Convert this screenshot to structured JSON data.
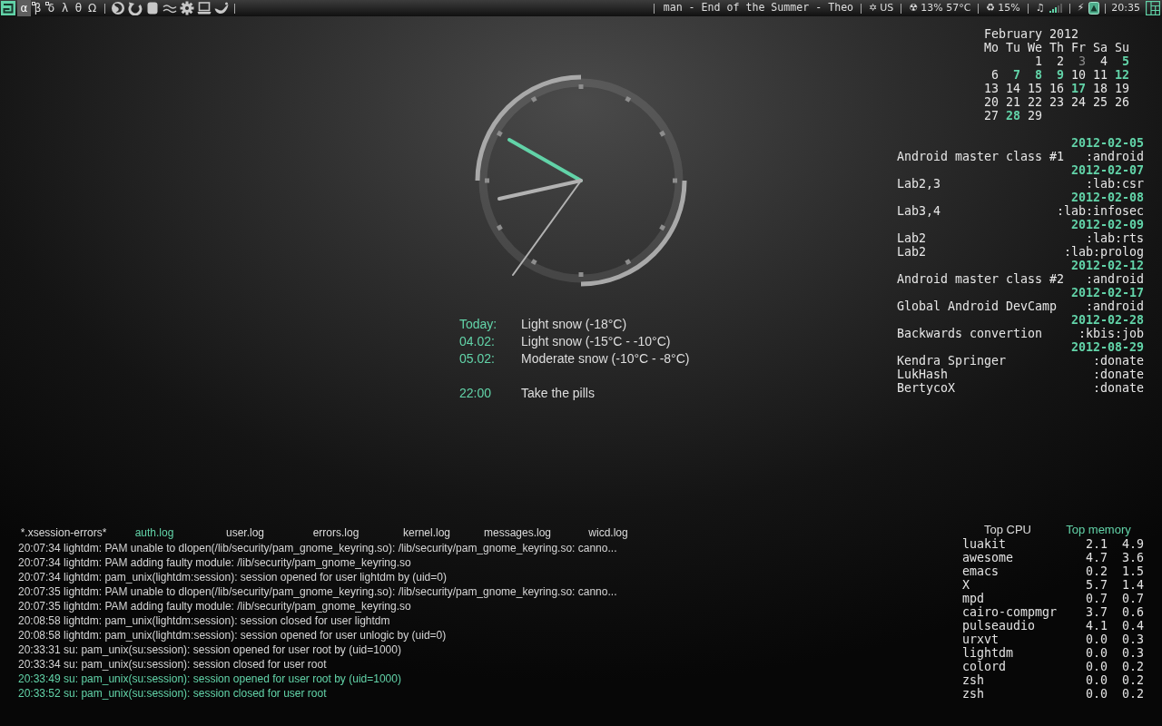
{
  "top_bar": {
    "tags": [
      {
        "label": "α",
        "selected": true,
        "occupied": false
      },
      {
        "label": "β",
        "selected": false,
        "occupied": true
      },
      {
        "label": "δ",
        "selected": false,
        "occupied": true
      },
      {
        "label": "λ",
        "selected": false,
        "occupied": false
      },
      {
        "label": "θ",
        "selected": false,
        "occupied": false
      },
      {
        "label": "Ω",
        "selected": false,
        "occupied": false
      }
    ],
    "now_playing": "man - End of the Summer - Theo",
    "widgets": [
      {
        "kind": "keyboard",
        "symbol": "✡",
        "text": "US"
      },
      {
        "kind": "cpu",
        "symbol": "☢",
        "text": "13% 57°C"
      },
      {
        "kind": "memory",
        "symbol": "♻",
        "text": "15%"
      },
      {
        "kind": "volume",
        "symbol": "♫"
      },
      {
        "kind": "power",
        "symbol": "⚡"
      }
    ],
    "clock": "20:35"
  },
  "calendar": {
    "title": "February 2012",
    "weekdays": [
      "Mo",
      "Tu",
      "We",
      "Th",
      "Fr",
      "Sa",
      "Su"
    ],
    "weeks": [
      [
        {
          "day": "1",
          "marked": false,
          "today": false
        },
        {
          "day": "2",
          "marked": false,
          "today": false
        },
        {
          "day": "3",
          "marked": false,
          "today": true
        },
        {
          "day": "4",
          "marked": false,
          "today": false
        },
        {
          "day": "5",
          "marked": true,
          "today": false
        }
      ],
      [
        {
          "day": "6",
          "marked": false,
          "today": false
        },
        {
          "day": "7",
          "marked": true,
          "today": false
        },
        {
          "day": "8",
          "marked": true,
          "today": false
        },
        {
          "day": "9",
          "marked": true,
          "today": false
        },
        {
          "day": "10",
          "marked": false,
          "today": false
        },
        {
          "day": "11",
          "marked": false,
          "today": false
        },
        {
          "day": "12",
          "marked": true,
          "today": false
        }
      ],
      [
        {
          "day": "13",
          "marked": false,
          "today": false
        },
        {
          "day": "14",
          "marked": false,
          "today": false
        },
        {
          "day": "15",
          "marked": false,
          "today": false
        },
        {
          "day": "16",
          "marked": false,
          "today": false
        },
        {
          "day": "17",
          "marked": true,
          "today": false
        },
        {
          "day": "18",
          "marked": false,
          "today": false
        },
        {
          "day": "19",
          "marked": false,
          "today": false
        }
      ],
      [
        {
          "day": "20",
          "marked": false,
          "today": false
        },
        {
          "day": "21",
          "marked": false,
          "today": false
        },
        {
          "day": "22",
          "marked": false,
          "today": false
        },
        {
          "day": "23",
          "marked": false,
          "today": false
        },
        {
          "day": "24",
          "marked": false,
          "today": false
        },
        {
          "day": "25",
          "marked": false,
          "today": false
        },
        {
          "day": "26",
          "marked": false,
          "today": false
        }
      ],
      [
        {
          "day": "27",
          "marked": false,
          "today": false
        },
        {
          "day": "28",
          "marked": true,
          "today": false
        },
        {
          "day": "29",
          "marked": false,
          "today": false
        }
      ]
    ]
  },
  "agenda": [
    {
      "date": "2012-02-05",
      "events": [
        {
          "title": "Android master class #1",
          "tag": ":android"
        }
      ]
    },
    {
      "date": "2012-02-07",
      "events": [
        {
          "title": "Lab2,3",
          "tag": ":lab:csr"
        }
      ]
    },
    {
      "date": "2012-02-08",
      "events": [
        {
          "title": "Lab3,4",
          "tag": ":lab:infosec"
        }
      ]
    },
    {
      "date": "2012-02-09",
      "events": [
        {
          "title": "Lab2",
          "tag": ":lab:rts"
        },
        {
          "title": "Lab2",
          "tag": ":lab:prolog"
        }
      ]
    },
    {
      "date": "2012-02-12",
      "events": [
        {
          "title": "Android master class #2",
          "tag": ":android"
        }
      ]
    },
    {
      "date": "2012-02-17",
      "events": [
        {
          "title": "Global Android DevCamp",
          "tag": ":android"
        }
      ]
    },
    {
      "date": "2012-02-28",
      "events": [
        {
          "title": "Backwards convertion",
          "tag": ":kbis:job"
        }
      ]
    },
    {
      "date": "2012-08-29",
      "events": [
        {
          "title": "Kendra Springer",
          "tag": ":donate"
        },
        {
          "title": "LukHash",
          "tag": ":donate"
        },
        {
          "title": "BertycoX",
          "tag": ":donate"
        }
      ]
    }
  ],
  "weather": [
    {
      "label": "Today:",
      "text": "Light snow (-18°C)"
    },
    {
      "label": "04.02:",
      "text": "Light snow (-15°C - -10°C)"
    },
    {
      "label": "05.02:",
      "text": "Moderate snow (-10°C - -8°C)"
    }
  ],
  "reminders": [
    {
      "time": "22:00",
      "text": "Take the pills"
    }
  ],
  "log_viewer": {
    "tabs": [
      {
        "label": "*.xsession-errors*",
        "selected": false
      },
      {
        "label": "auth.log",
        "selected": true
      },
      {
        "label": "user.log",
        "selected": false
      },
      {
        "label": "errors.log",
        "selected": false
      },
      {
        "label": "kernel.log",
        "selected": false
      },
      {
        "label": "messages.log",
        "selected": false
      },
      {
        "label": "wicd.log",
        "selected": false
      }
    ],
    "lines": [
      {
        "text": "20:07:34 lightdm: PAM unable to dlopen(/lib/security/pam_gnome_keyring.so): /lib/security/pam_gnome_keyring.so: canno...",
        "highlighted": false
      },
      {
        "text": "20:07:34 lightdm: PAM adding faulty module: /lib/security/pam_gnome_keyring.so",
        "highlighted": false
      },
      {
        "text": "20:07:34 lightdm: pam_unix(lightdm:session): session opened for user lightdm by (uid=0)",
        "highlighted": false
      },
      {
        "text": "20:07:35 lightdm: PAM unable to dlopen(/lib/security/pam_gnome_keyring.so): /lib/security/pam_gnome_keyring.so: canno...",
        "highlighted": false
      },
      {
        "text": "20:07:35 lightdm: PAM adding faulty module: /lib/security/pam_gnome_keyring.so",
        "highlighted": false
      },
      {
        "text": "20:08:58 lightdm: pam_unix(lightdm:session): session closed for user lightdm",
        "highlighted": false
      },
      {
        "text": "20:08:58 lightdm: pam_unix(lightdm:session): session opened for user unlogic by (uid=0)",
        "highlighted": false
      },
      {
        "text": "20:33:31 su: pam_unix(su:session): session opened for user root by (uid=1000)",
        "highlighted": false
      },
      {
        "text": "20:33:34 su: pam_unix(su:session): session closed for user root",
        "highlighted": false
      },
      {
        "text": "20:33:49 su: pam_unix(su:session): session opened for user root by (uid=1000)",
        "highlighted": true
      },
      {
        "text": "20:33:52 su: pam_unix(su:session): session closed for user root",
        "highlighted": true
      }
    ]
  },
  "top_processes": {
    "tabs": [
      {
        "label": "Top CPU",
        "selected": false
      },
      {
        "label": "Top memory",
        "selected": true
      }
    ],
    "rows": [
      {
        "column_1": "luakit",
        "column_2": "2.1",
        "column_3": "4.9"
      },
      {
        "column_1": "awesome",
        "column_2": "4.7",
        "column_3": "3.6"
      },
      {
        "column_1": "emacs",
        "column_2": "0.2",
        "column_3": "1.5"
      },
      {
        "column_1": "X",
        "column_2": "5.7",
        "column_3": "1.4"
      },
      {
        "column_1": "mpd",
        "column_2": "0.7",
        "column_3": "0.7"
      },
      {
        "column_1": "cairo-compmgr",
        "column_2": "3.7",
        "column_3": "0.6"
      },
      {
        "column_1": "pulseaudio",
        "column_2": "4.1",
        "column_3": "0.4"
      },
      {
        "column_1": "urxvt",
        "column_2": "0.0",
        "column_3": "0.3"
      },
      {
        "column_1": "lightdm",
        "column_2": "0.0",
        "column_3": "0.3"
      },
      {
        "column_1": "colord",
        "column_2": "0.0",
        "column_3": "0.2"
      },
      {
        "column_1": "zsh",
        "column_2": "0.0",
        "column_3": "0.2"
      },
      {
        "column_1": "zsh",
        "column_2": "0.0",
        "column_3": "0.2"
      }
    ]
  }
}
